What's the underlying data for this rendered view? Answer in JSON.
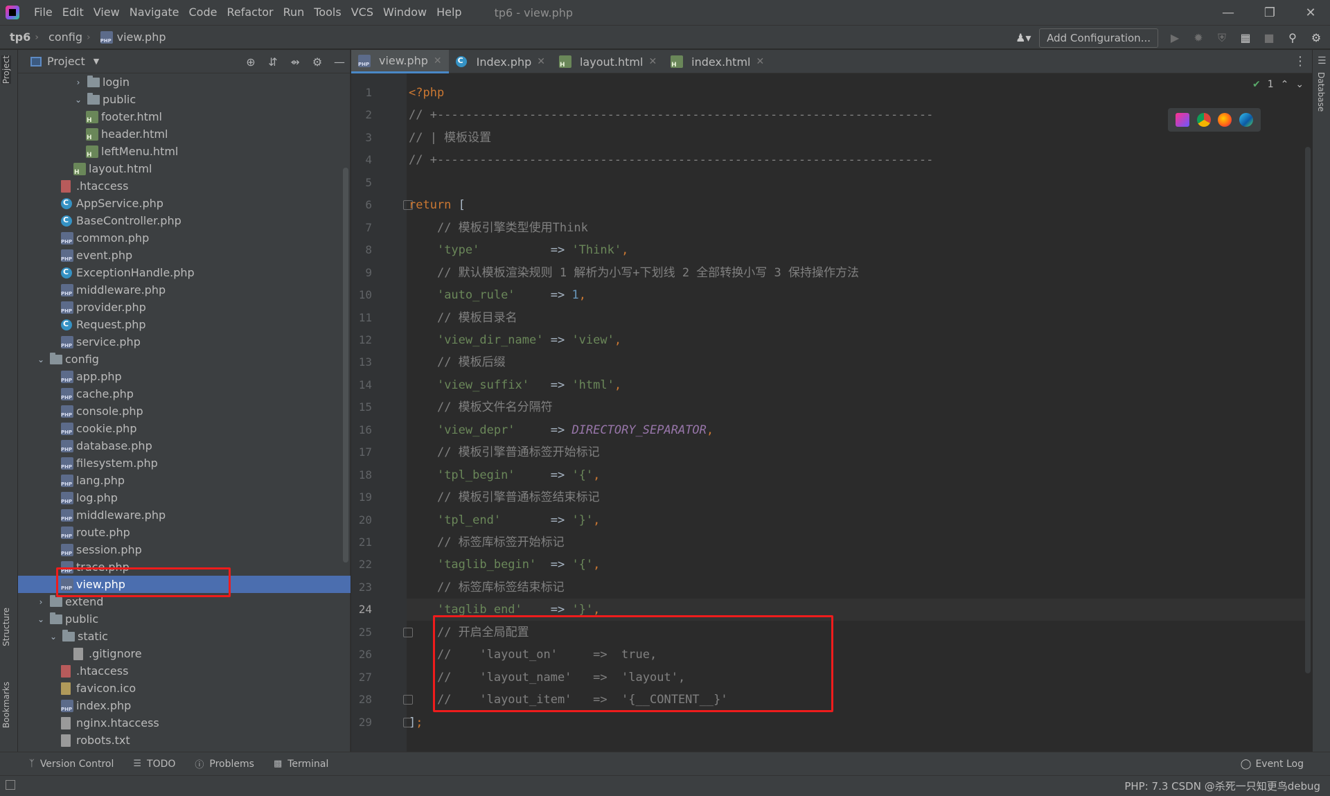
{
  "app": {
    "window_title": "tp6 - view.php",
    "menu": [
      "File",
      "Edit",
      "View",
      "Navigate",
      "Code",
      "Refactor",
      "Run",
      "Tools",
      "VCS",
      "Window",
      "Help"
    ],
    "window_controls": [
      "minimize-icon",
      "restore-icon",
      "close-icon"
    ]
  },
  "navbar": {
    "breadcrumb": [
      "tp6",
      "config",
      "view.php"
    ],
    "add_configuration": "Add Configuration..."
  },
  "left_stripe": {
    "project": "Project",
    "structure": "Structure",
    "bookmarks": "Bookmarks"
  },
  "right_stripe": {
    "database": "Database"
  },
  "project_panel": {
    "title": "Project",
    "tree": [
      {
        "label": "login",
        "type": "folder",
        "arrow": "right"
      },
      {
        "label": "public",
        "type": "folder",
        "arrow": "down"
      },
      {
        "label": "footer.html",
        "type": "html"
      },
      {
        "label": "header.html",
        "type": "html"
      },
      {
        "label": "leftMenu.html",
        "type": "html"
      },
      {
        "label": "layout.html",
        "type": "html"
      },
      {
        "label": ".htaccess",
        "type": "ht"
      },
      {
        "label": "AppService.php",
        "type": "cls"
      },
      {
        "label": "BaseController.php",
        "type": "cls"
      },
      {
        "label": "common.php",
        "type": "php"
      },
      {
        "label": "event.php",
        "type": "php"
      },
      {
        "label": "ExceptionHandle.php",
        "type": "cls"
      },
      {
        "label": "middleware.php",
        "type": "php"
      },
      {
        "label": "provider.php",
        "type": "php"
      },
      {
        "label": "Request.php",
        "type": "cls"
      },
      {
        "label": "service.php",
        "type": "php"
      },
      {
        "label": "config",
        "type": "folder",
        "arrow": "down"
      },
      {
        "label": "app.php",
        "type": "php"
      },
      {
        "label": "cache.php",
        "type": "php"
      },
      {
        "label": "console.php",
        "type": "php"
      },
      {
        "label": "cookie.php",
        "type": "php"
      },
      {
        "label": "database.php",
        "type": "php"
      },
      {
        "label": "filesystem.php",
        "type": "php"
      },
      {
        "label": "lang.php",
        "type": "php"
      },
      {
        "label": "log.php",
        "type": "php"
      },
      {
        "label": "middleware.php",
        "type": "php"
      },
      {
        "label": "route.php",
        "type": "php"
      },
      {
        "label": "session.php",
        "type": "php"
      },
      {
        "label": "trace.php",
        "type": "php"
      },
      {
        "label": "view.php",
        "type": "php",
        "selected": true
      },
      {
        "label": "extend",
        "type": "folder",
        "arrow": "right"
      },
      {
        "label": "public",
        "type": "folder",
        "arrow": "down"
      },
      {
        "label": "static",
        "type": "folder",
        "arrow": "down"
      },
      {
        "label": ".gitignore",
        "type": "text"
      },
      {
        "label": ".htaccess",
        "type": "ht"
      },
      {
        "label": "favicon.ico",
        "type": "ico"
      },
      {
        "label": "index.php",
        "type": "php"
      },
      {
        "label": "nginx.htaccess",
        "type": "text"
      },
      {
        "label": "robots.txt",
        "type": "text"
      }
    ]
  },
  "editor": {
    "tabs": [
      {
        "label": "view.php",
        "icon": "php",
        "active": true
      },
      {
        "label": "Index.php",
        "icon": "cls"
      },
      {
        "label": "layout.html",
        "icon": "html"
      },
      {
        "label": "index.html",
        "icon": "html"
      }
    ],
    "line_numbers": [
      "1",
      "2",
      "3",
      "4",
      "5",
      "6",
      "7",
      "8",
      "9",
      "10",
      "11",
      "12",
      "13",
      "14",
      "15",
      "16",
      "17",
      "18",
      "19",
      "20",
      "21",
      "22",
      "23",
      "24",
      "25",
      "26",
      "27",
      "28",
      "29"
    ],
    "current_line": 24,
    "inspection_count": "1",
    "code": [
      [
        [
          "tag",
          "<?php"
        ]
      ],
      [
        [
          "com",
          "// +----------------------------------------------------------------------"
        ]
      ],
      [
        [
          "com",
          "// | 模板设置"
        ]
      ],
      [
        [
          "com",
          "// +----------------------------------------------------------------------"
        ]
      ],
      [],
      [
        [
          "kw",
          "return "
        ],
        [
          "op",
          "["
        ]
      ],
      [
        [
          "op",
          "    "
        ],
        [
          "com",
          "// 模板引擎类型使用Think"
        ]
      ],
      [
        [
          "op",
          "    "
        ],
        [
          "str",
          "'type'"
        ],
        [
          "op",
          "          => "
        ],
        [
          "str",
          "'Think'"
        ],
        [
          "kw",
          ","
        ]
      ],
      [
        [
          "op",
          "    "
        ],
        [
          "com",
          "// 默认模板渲染规则 1 解析为小写+下划线 2 全部转换小写 3 保持操作方法"
        ]
      ],
      [
        [
          "op",
          "    "
        ],
        [
          "str",
          "'auto_rule'"
        ],
        [
          "op",
          "     => "
        ],
        [
          "num",
          "1"
        ],
        [
          "kw",
          ","
        ]
      ],
      [
        [
          "op",
          "    "
        ],
        [
          "com",
          "// 模板目录名"
        ]
      ],
      [
        [
          "op",
          "    "
        ],
        [
          "str",
          "'view_dir_name'"
        ],
        [
          "op",
          " => "
        ],
        [
          "str",
          "'view'"
        ],
        [
          "kw",
          ","
        ]
      ],
      [
        [
          "op",
          "    "
        ],
        [
          "com",
          "// 模板后缀"
        ]
      ],
      [
        [
          "op",
          "    "
        ],
        [
          "str",
          "'view_suffix'"
        ],
        [
          "op",
          "   => "
        ],
        [
          "str",
          "'html'"
        ],
        [
          "kw",
          ","
        ]
      ],
      [
        [
          "op",
          "    "
        ],
        [
          "com",
          "// 模板文件名分隔符"
        ]
      ],
      [
        [
          "op",
          "    "
        ],
        [
          "str",
          "'view_depr'"
        ],
        [
          "op",
          "     => "
        ],
        [
          "const",
          "DIRECTORY_SEPARATOR"
        ],
        [
          "kw",
          ","
        ]
      ],
      [
        [
          "op",
          "    "
        ],
        [
          "com",
          "// 模板引擎普通标签开始标记"
        ]
      ],
      [
        [
          "op",
          "    "
        ],
        [
          "str",
          "'tpl_begin'"
        ],
        [
          "op",
          "     => "
        ],
        [
          "str",
          "'{'"
        ],
        [
          "kw",
          ","
        ]
      ],
      [
        [
          "op",
          "    "
        ],
        [
          "com",
          "// 模板引擎普通标签结束标记"
        ]
      ],
      [
        [
          "op",
          "    "
        ],
        [
          "str",
          "'tpl_end'"
        ],
        [
          "op",
          "       => "
        ],
        [
          "str",
          "'}'"
        ],
        [
          "kw",
          ","
        ]
      ],
      [
        [
          "op",
          "    "
        ],
        [
          "com",
          "// 标签库标签开始标记"
        ]
      ],
      [
        [
          "op",
          "    "
        ],
        [
          "str",
          "'taglib_begin'"
        ],
        [
          "op",
          "  => "
        ],
        [
          "str",
          "'{'"
        ],
        [
          "kw",
          ","
        ]
      ],
      [
        [
          "op",
          "    "
        ],
        [
          "com",
          "// 标签库标签结束标记"
        ]
      ],
      [
        [
          "op",
          "    "
        ],
        [
          "str",
          "'taglib_end'"
        ],
        [
          "op",
          "    => "
        ],
        [
          "str",
          "'}'"
        ],
        [
          "kw",
          ","
        ]
      ],
      [
        [
          "op",
          "    "
        ],
        [
          "com",
          "// 开启全局配置"
        ]
      ],
      [
        [
          "op",
          "    "
        ],
        [
          "com",
          "//    'layout_on'     =>  true,"
        ]
      ],
      [
        [
          "op",
          "    "
        ],
        [
          "com",
          "//    'layout_name'   =>  'layout',"
        ]
      ],
      [
        [
          "op",
          "    "
        ],
        [
          "com",
          "//    'layout_item'   =>  '{__CONTENT__}'"
        ]
      ],
      [
        [
          "op",
          "]"
        ],
        [
          "kw",
          ";"
        ]
      ]
    ]
  },
  "bottom_tools": [
    "Version Control",
    "TODO",
    "Problems",
    "Terminal"
  ],
  "event_log": "Event Log",
  "status_right": "PHP: 7.3  CSDN @杀死一只知更鸟debug",
  "colors": {
    "accent": "#4a88c7",
    "selection": "#4b6eaf",
    "highlight_box": "#ee1c1c"
  }
}
